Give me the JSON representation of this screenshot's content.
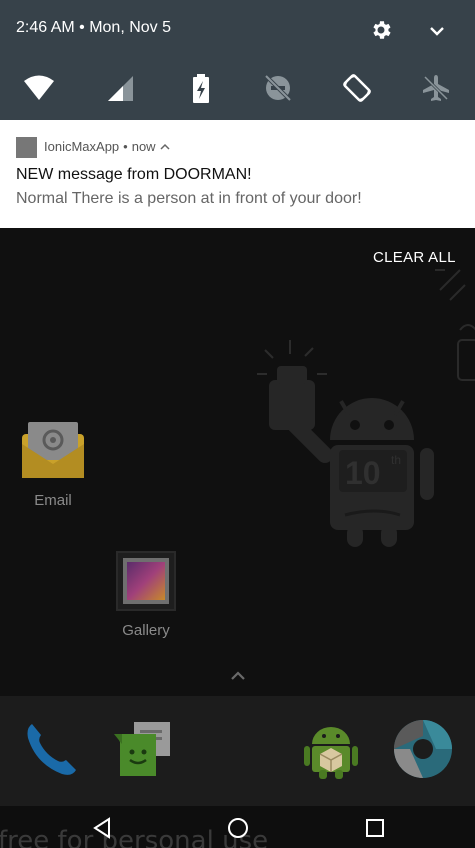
{
  "status": {
    "time_date": "2:46 AM • Mon, Nov 5"
  },
  "quick_settings": {
    "tiles": [
      {
        "icon": "wifi-icon"
      },
      {
        "icon": "signal-icon"
      },
      {
        "icon": "battery-saver-icon"
      },
      {
        "icon": "do-not-disturb-icon"
      },
      {
        "icon": "auto-rotate-icon"
      },
      {
        "icon": "airplane-mode-icon"
      }
    ]
  },
  "notification": {
    "app_name": "IonicMaxApp",
    "time": "now",
    "title": "NEW message from DOORMAN!",
    "body": "Normal There is a person at in front of your door!"
  },
  "clear_all_label": "CLEAR ALL",
  "home": {
    "apps": [
      {
        "label": "Email"
      },
      {
        "label": "Gallery"
      }
    ],
    "wallpaper_badge": "10",
    "wallpaper_badge_sup": "th"
  },
  "dock": [
    "phone-icon",
    "messenger-icon",
    "store-icon",
    "camera-icon"
  ],
  "watermark": "free for personal use",
  "colors": {
    "qs_background": "#37424a",
    "notification_background": "#ffffff",
    "dock_background": "#1c1c1c"
  }
}
